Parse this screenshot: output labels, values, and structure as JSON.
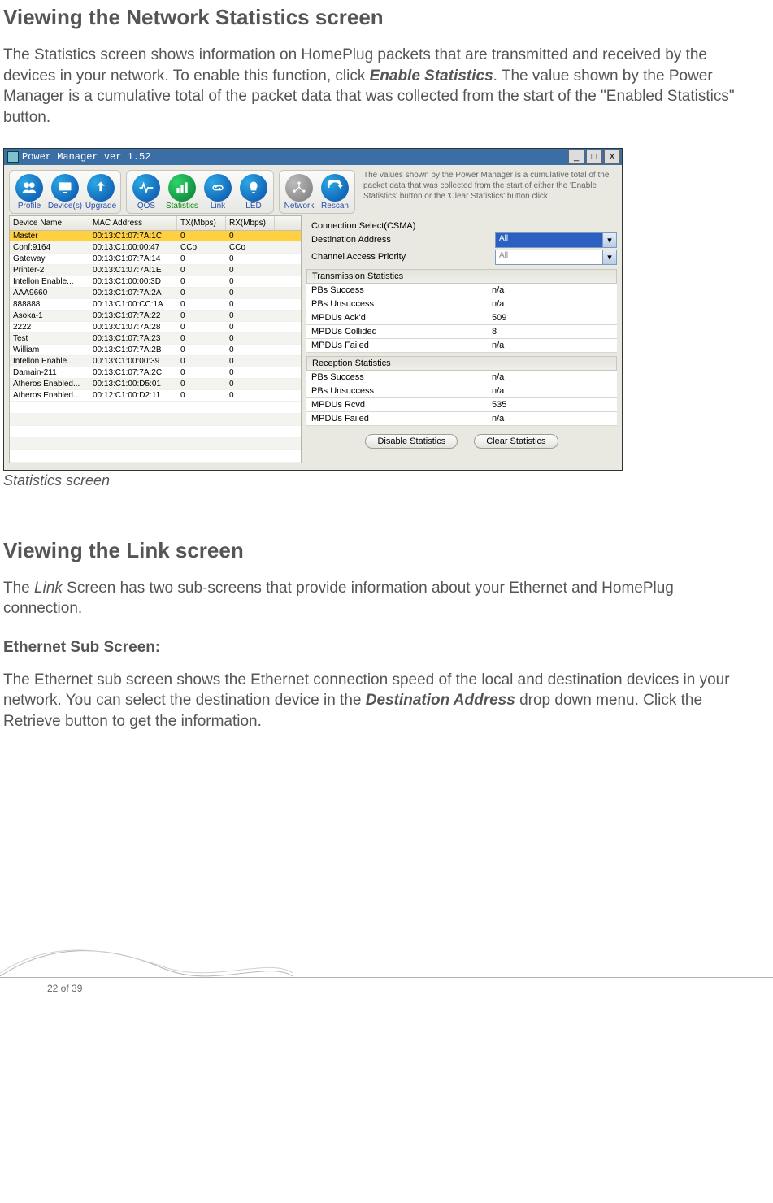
{
  "headings": {
    "h1a": "Viewing the Network Statistics screen",
    "h1b": "Viewing the Link screen",
    "sub_eth": "Ethernet Sub Screen:"
  },
  "paras": {
    "p1_a": "The Statistics screen shows information on HomePlug packets that are transmitted and received by the devices in your network. To enable this function, click ",
    "p1_b": "Enable Statistics",
    "p1_c": ". The value shown by the Power Manager is a cumulative total of the packet data that was collected from the start of the \"Enabled Statistics\" button.",
    "caption": "Statistics screen",
    "p2_a": "The ",
    "p2_b": "Link",
    "p2_c": " Screen has two sub-screens that provide information about your Ethernet and HomePlug connection.",
    "p3_a": "The Ethernet sub screen shows the Ethernet connection speed of the local and destination devices in your network. You can select the destination device in the ",
    "p3_b": "Destination Address",
    "p3_c": " drop down menu. Click the Retrieve button to get the information."
  },
  "shot": {
    "title": "Power Manager ver 1.52",
    "winbtns": {
      "min": "_",
      "max": "□",
      "close": "X"
    },
    "desc": "The values shown by the Power Manager is a cumulative total of the packet data that was collected from the start of either the 'Enable Statistics' button or the 'Clear Statistics' button click.",
    "toolbar": [
      {
        "id": "profile",
        "label": "Profile"
      },
      {
        "id": "devices",
        "label": "Device(s)"
      },
      {
        "id": "upgrade",
        "label": "Upgrade"
      },
      {
        "id": "qos",
        "label": "QOS"
      },
      {
        "id": "statistics",
        "label": "Statistics",
        "active": true
      },
      {
        "id": "link",
        "label": "Link"
      },
      {
        "id": "led",
        "label": "LED"
      },
      {
        "id": "network",
        "label": "Network"
      },
      {
        "id": "rescan",
        "label": "Rescan"
      }
    ],
    "grid": {
      "headers": {
        "name": "Device Name",
        "mac": "MAC Address",
        "tx": "TX(Mbps)",
        "rx": "RX(Mbps)"
      },
      "rows": [
        {
          "name": "Master",
          "mac": "00:13:C1:07:7A:1C",
          "tx": "0",
          "rx": "0",
          "sel": true
        },
        {
          "name": "Conf:9164",
          "mac": "00:13:C1:00:00:47",
          "tx": "CCo",
          "rx": "CCo"
        },
        {
          "name": "Gateway",
          "mac": "00:13:C1:07:7A:14",
          "tx": "0",
          "rx": "0"
        },
        {
          "name": "Printer-2",
          "mac": "00:13:C1:07:7A:1E",
          "tx": "0",
          "rx": "0"
        },
        {
          "name": "Intellon Enable...",
          "mac": "00:13:C1:00:00:3D",
          "tx": "0",
          "rx": "0"
        },
        {
          "name": "AAA9660",
          "mac": "00:13:C1:07:7A:2A",
          "tx": "0",
          "rx": "0"
        },
        {
          "name": "888888",
          "mac": "00:13:C1:00:CC:1A",
          "tx": "0",
          "rx": "0"
        },
        {
          "name": "Asoka-1",
          "mac": "00:13:C1:07:7A:22",
          "tx": "0",
          "rx": "0"
        },
        {
          "name": "2222",
          "mac": "00:13:C1:07:7A:28",
          "tx": "0",
          "rx": "0"
        },
        {
          "name": "Test",
          "mac": "00:13:C1:07:7A:23",
          "tx": "0",
          "rx": "0"
        },
        {
          "name": "William",
          "mac": "00:13:C1:07:7A:2B",
          "tx": "0",
          "rx": "0"
        },
        {
          "name": "Intellon Enable...",
          "mac": "00:13:C1:00:00:39",
          "tx": "0",
          "rx": "0"
        },
        {
          "name": "Damain-211",
          "mac": "00:13:C1:07:7A:2C",
          "tx": "0",
          "rx": "0"
        },
        {
          "name": "Atheros Enabled...",
          "mac": "00:13:C1:00:D5:01",
          "tx": "0",
          "rx": "0"
        },
        {
          "name": "Atheros Enabled...",
          "mac": "00:12:C1:00:D2:11",
          "tx": "0",
          "rx": "0"
        }
      ]
    },
    "right": {
      "conn_label": "Connection Select(CSMA)",
      "dest_label": "Destination Address",
      "dest_value": "All",
      "prio_label": "Channel Access Priority",
      "prio_value": "All",
      "tx_section": "Transmission Statistics",
      "rx_section": "Reception Statistics",
      "tx_rows": [
        {
          "l": "PBs Success",
          "v": "n/a"
        },
        {
          "l": "PBs Unsuccess",
          "v": "n/a"
        },
        {
          "l": "MPDUs Ack'd",
          "v": "509"
        },
        {
          "l": "MPDUs Collided",
          "v": "8"
        },
        {
          "l": "MPDUs Failed",
          "v": "n/a"
        }
      ],
      "rx_rows": [
        {
          "l": "PBs Success",
          "v": "n/a"
        },
        {
          "l": "PBs Unsuccess",
          "v": "n/a"
        },
        {
          "l": "MPDUs Rcvd",
          "v": "535"
        },
        {
          "l": "MPDUs Failed",
          "v": "n/a"
        }
      ],
      "btn_disable": "Disable Statistics",
      "btn_clear": "Clear Statistics"
    }
  },
  "footer": {
    "page": "22 of 39"
  }
}
